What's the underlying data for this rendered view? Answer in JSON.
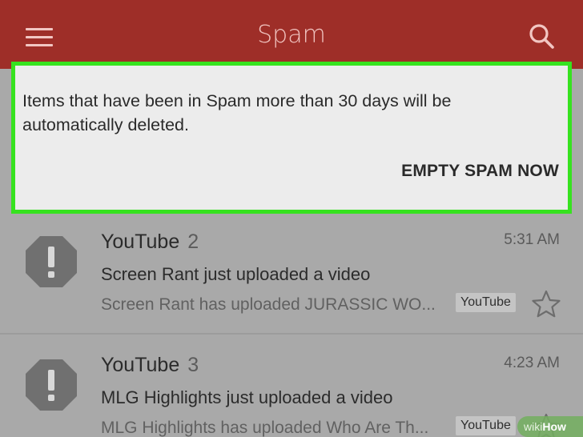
{
  "appbar": {
    "title": "Spam",
    "menu_icon": "hamburger-menu-icon",
    "search_icon": "search-icon",
    "color": "#9e2e28"
  },
  "banner": {
    "message": "Items that have been in Spam more than 30 days will be automatically deleted.",
    "action_label": "EMPTY SPAM NOW",
    "highlight_color": "#36e21f"
  },
  "emails": [
    {
      "sender": "YouTube",
      "count": "2",
      "time": "5:31 AM",
      "subject": "Screen Rant just uploaded a video",
      "snippet": "Screen Rant has uploaded JURASSIC WO...",
      "label": "YouTube",
      "avatar_icon": "spam-warning-icon",
      "star_icon": "star-outline-icon"
    },
    {
      "sender": "YouTube",
      "count": "3",
      "time": "4:23 AM",
      "subject": "MLG Highlights just uploaded a video",
      "snippet": "MLG Highlights has uploaded Who Are Th...",
      "label": "YouTube",
      "avatar_icon": "spam-warning-icon",
      "star_icon": "star-outline-icon"
    }
  ],
  "watermark": {
    "part1": "wiki",
    "part2": "How"
  }
}
